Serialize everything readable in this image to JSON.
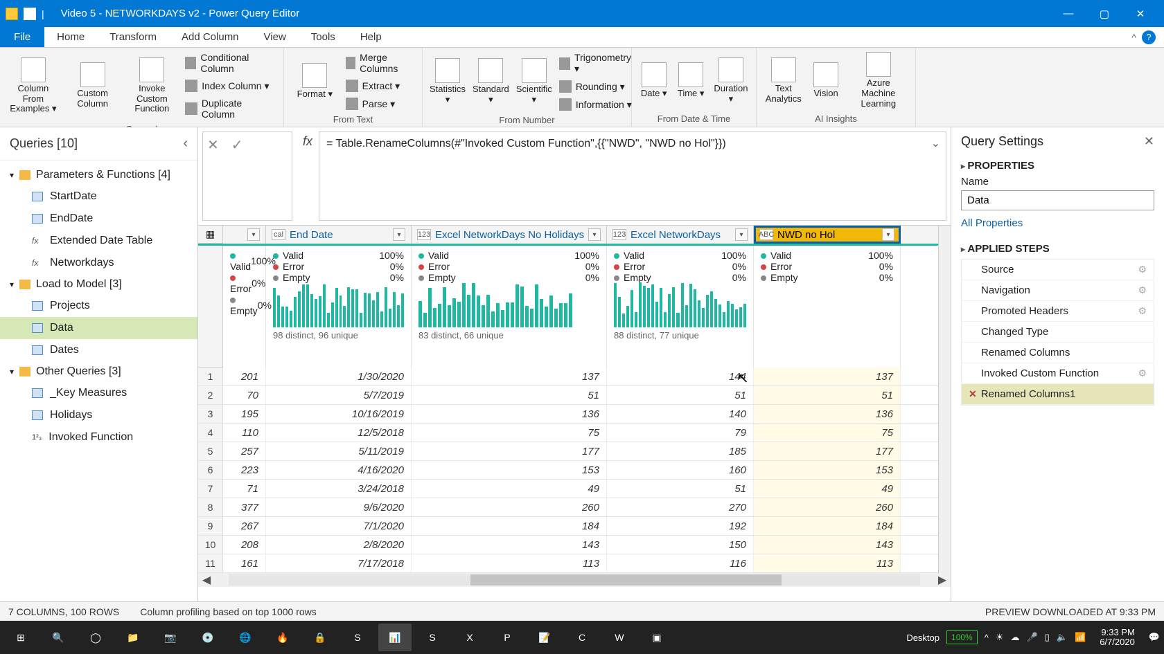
{
  "window": {
    "title": "Video 5 - NETWORKDAYS v2 - Power Query Editor"
  },
  "menubar": {
    "file": "File",
    "tabs": [
      "Home",
      "Transform",
      "Add Column",
      "View",
      "Tools",
      "Help"
    ],
    "active": 2
  },
  "ribbon": {
    "general": {
      "label": "General",
      "big": [
        {
          "name": "column-from-examples",
          "txt": "Column From Examples ▾"
        },
        {
          "name": "custom-column",
          "txt": "Custom Column"
        },
        {
          "name": "invoke-custom-function",
          "txt": "Invoke Custom Function"
        }
      ],
      "stack": [
        {
          "name": "conditional-column",
          "txt": "Conditional Column"
        },
        {
          "name": "index-column",
          "txt": "Index Column ▾"
        },
        {
          "name": "duplicate-column",
          "txt": "Duplicate Column"
        }
      ]
    },
    "fromtext": {
      "label": "From Text",
      "big": [
        {
          "name": "format",
          "txt": "Format ▾"
        }
      ],
      "stack": [
        {
          "name": "merge-columns",
          "txt": "Merge Columns"
        },
        {
          "name": "extract",
          "txt": "Extract ▾"
        },
        {
          "name": "parse",
          "txt": "Parse ▾"
        }
      ]
    },
    "fromnumber": {
      "label": "From Number",
      "big": [
        {
          "name": "statistics",
          "txt": "Statistics ▾"
        },
        {
          "name": "standard",
          "txt": "Standard ▾"
        },
        {
          "name": "scientific",
          "txt": "Scientific ▾"
        }
      ],
      "stack": [
        {
          "name": "trigonometry",
          "txt": "Trigonometry ▾"
        },
        {
          "name": "rounding",
          "txt": "Rounding ▾"
        },
        {
          "name": "information",
          "txt": "Information ▾"
        }
      ]
    },
    "datetime": {
      "label": "From Date & Time",
      "big": [
        {
          "name": "date",
          "txt": "Date ▾"
        },
        {
          "name": "time",
          "txt": "Time ▾"
        },
        {
          "name": "duration",
          "txt": "Duration ▾"
        }
      ]
    },
    "ai": {
      "label": "AI Insights",
      "big": [
        {
          "name": "text-analytics",
          "txt": "Text Analytics"
        },
        {
          "name": "vision",
          "txt": "Vision"
        },
        {
          "name": "azure-ml",
          "txt": "Azure Machine Learning"
        }
      ]
    }
  },
  "queries": {
    "title": "Queries [10]",
    "folders": [
      {
        "name": "Parameters & Functions [4]",
        "items": [
          {
            "label": "StartDate",
            "icon": "tbl"
          },
          {
            "label": "EndDate",
            "icon": "tbl"
          },
          {
            "label": "Extended Date Table",
            "icon": "fx"
          },
          {
            "label": "Networkdays",
            "icon": "fx"
          }
        ]
      },
      {
        "name": "Load to Model [3]",
        "items": [
          {
            "label": "Projects",
            "icon": "tbl"
          },
          {
            "label": "Data",
            "icon": "tbl",
            "selected": true
          },
          {
            "label": "Dates",
            "icon": "tbl"
          }
        ]
      },
      {
        "name": "Other Queries [3]",
        "items": [
          {
            "label": "_Key Measures",
            "icon": "tbl"
          },
          {
            "label": "Holidays",
            "icon": "tbl"
          },
          {
            "label": "Invoked Function",
            "icon": "123"
          }
        ]
      }
    ]
  },
  "formula": "= Table.RenameColumns(#\"Invoked Custom Function\",{{\"NWD\", \"NWD no Hol\"}})",
  "grid": {
    "columns": [
      {
        "name": "",
        "type": "123",
        "w": "col0"
      },
      {
        "name": "End Date",
        "type": "cal",
        "w": "col1"
      },
      {
        "name": "Excel NetworkDays No Holidays",
        "type": "123",
        "w": "col2"
      },
      {
        "name": "Excel NetworkDays",
        "type": "123",
        "w": "col3"
      },
      {
        "name": "NWD no Hol",
        "type": "ABC",
        "w": "col4",
        "selected": true
      }
    ],
    "quality": [
      {
        "valid": "100%",
        "error": "0%",
        "empty": "0%",
        "distinct": ""
      },
      {
        "valid": "100%",
        "error": "0%",
        "empty": "0%",
        "distinct": "98 distinct, 96 unique"
      },
      {
        "valid": "100%",
        "error": "0%",
        "empty": "0%",
        "distinct": "83 distinct, 66 unique"
      },
      {
        "valid": "100%",
        "error": "0%",
        "empty": "0%",
        "distinct": "88 distinct, 77 unique"
      },
      {
        "valid": "100%",
        "error": "0%",
        "empty": "0%",
        "distinct": ""
      }
    ],
    "rows": [
      [
        "201",
        "1/30/2020",
        "137",
        "144",
        "137"
      ],
      [
        "70",
        "5/7/2019",
        "51",
        "51",
        "51"
      ],
      [
        "195",
        "10/16/2019",
        "136",
        "140",
        "136"
      ],
      [
        "110",
        "12/5/2018",
        "75",
        "79",
        "75"
      ],
      [
        "257",
        "5/11/2019",
        "177",
        "185",
        "177"
      ],
      [
        "223",
        "4/16/2020",
        "153",
        "160",
        "153"
      ],
      [
        "71",
        "3/24/2018",
        "49",
        "51",
        "49"
      ],
      [
        "377",
        "9/6/2020",
        "260",
        "270",
        "260"
      ],
      [
        "267",
        "7/1/2020",
        "184",
        "192",
        "184"
      ],
      [
        "208",
        "2/8/2020",
        "143",
        "150",
        "143"
      ],
      [
        "161",
        "7/17/2018",
        "113",
        "116",
        "113"
      ]
    ]
  },
  "settings": {
    "title": "Query Settings",
    "properties": "PROPERTIES",
    "name_label": "Name",
    "name_value": "Data",
    "all_properties": "All Properties",
    "applied": "APPLIED STEPS",
    "steps": [
      {
        "label": "Source",
        "gear": true
      },
      {
        "label": "Navigation",
        "gear": true
      },
      {
        "label": "Promoted Headers",
        "gear": true
      },
      {
        "label": "Changed Type"
      },
      {
        "label": "Renamed Columns"
      },
      {
        "label": "Invoked Custom Function",
        "gear": true
      },
      {
        "label": "Renamed Columns1",
        "selected": true,
        "x": true
      }
    ]
  },
  "status": {
    "left": "7 COLUMNS, 100 ROWS",
    "mid": "Column profiling based on top 1000 rows",
    "right": "PREVIEW DOWNLOADED AT 9:33 PM"
  },
  "taskbar": {
    "desktop": "Desktop",
    "battery": "100%",
    "time": "9:33 PM",
    "date": "6/7/2020"
  }
}
